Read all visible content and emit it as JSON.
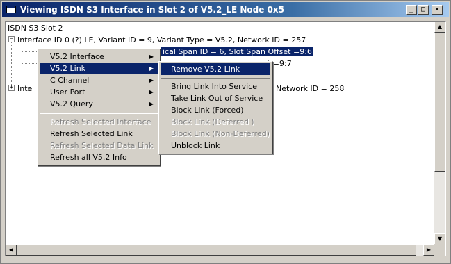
{
  "window": {
    "title": "Viewing ISDN S3 Interface in Slot  2 of V5.2_LE Node 0x5",
    "controls": {
      "minimize": "_",
      "maximize": "□",
      "close": "×"
    }
  },
  "tree": {
    "root": "ISDN S3 Slot 2",
    "interface0": "Interface ID 0 (?) LE,  Variant ID = 9, Variant Type = V5.2,  Network ID = 257",
    "link1_visible": "ical Span ID = 6,  Slot:Span Offset =9:6",
    "link2_visible": "t =9:7",
    "interface1_prefix": "Inte",
    "interface1_suffix": "Network ID = 258",
    "expander_minus": "−",
    "expander_plus": "+"
  },
  "context_menu": {
    "items": [
      {
        "label": "V5.2 Interface",
        "submenu": true,
        "enabled": true
      },
      {
        "label": "V5.2 Link",
        "submenu": true,
        "enabled": true,
        "highlighted": true
      },
      {
        "label": "C Channel",
        "submenu": true,
        "enabled": true
      },
      {
        "label": "User Port",
        "submenu": true,
        "enabled": true
      },
      {
        "label": "V5.2 Query",
        "submenu": true,
        "enabled": true
      },
      {
        "label": "Refresh Selected Interface",
        "enabled": false
      },
      {
        "label": "Refresh Selected Link",
        "enabled": true
      },
      {
        "label": "Refresh Selected Data Link",
        "enabled": false
      },
      {
        "label": "Refresh all V5.2 Info",
        "enabled": true
      }
    ],
    "arrow": "▶"
  },
  "submenu": {
    "items": [
      {
        "label": "Remove  V5.2 Link",
        "enabled": true,
        "highlighted": true
      },
      {
        "label": "Bring Link Into Service",
        "enabled": true
      },
      {
        "label": "Take Link Out of Service",
        "enabled": true
      },
      {
        "label": "Block Link (Forced)",
        "enabled": true
      },
      {
        "label": "Block Link (Deferred )",
        "enabled": false
      },
      {
        "label": "Block Link (Non-Deferred)",
        "enabled": false
      },
      {
        "label": "Unblock Link",
        "enabled": true
      }
    ]
  },
  "scrollbars": {
    "up": "▲",
    "down": "▼",
    "left": "◀",
    "right": "▶"
  },
  "colors": {
    "titlebar_start": "#0a246a",
    "titlebar_end": "#a6caf0",
    "highlight": "#0a246a",
    "face": "#d4d0c8"
  }
}
